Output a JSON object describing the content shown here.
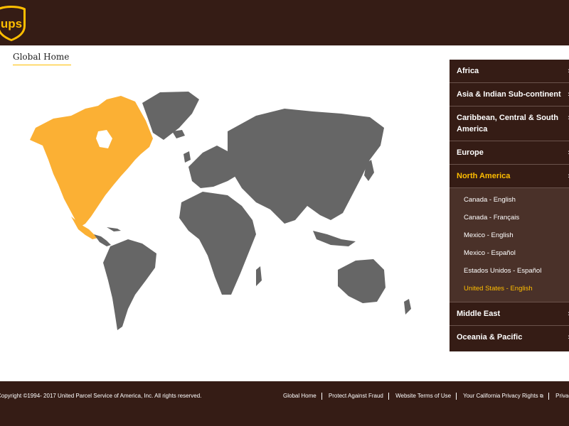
{
  "header": {
    "logo_text": "ups"
  },
  "breadcrumb": {
    "label": "Global Home"
  },
  "regions": [
    {
      "label": "Africa"
    },
    {
      "label": "Asia & Indian Sub-continent"
    },
    {
      "label": "Caribbean, Central & South America"
    },
    {
      "label": "Europe"
    },
    {
      "label": "North America",
      "expanded": true,
      "items": [
        "Canada - English",
        "Canada - Français",
        "Mexico - English",
        "Mexico - Español",
        "Estados Unidos - Español",
        "United States - English"
      ],
      "selected": "United States - English"
    },
    {
      "label": "Middle East"
    },
    {
      "label": "Oceania & Pacific"
    }
  ],
  "footer": {
    "copyright": "Copyright ©1994- 2017  United Parcel Service of America, Inc. All rights reserved.",
    "links": [
      "Global Home",
      "Protect Against Fraud",
      "Website Terms of Use",
      "Your California Privacy Rights",
      "Privacy Notice"
    ]
  },
  "colors": {
    "brown": "#351c15",
    "gold": "#ffbe00",
    "map_gray": "#666666",
    "highlight": "#fbb034"
  }
}
